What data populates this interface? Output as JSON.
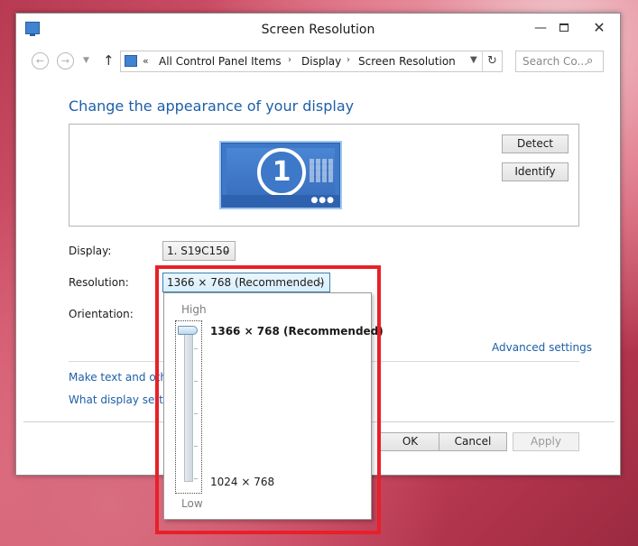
{
  "window": {
    "title": "Screen Resolution",
    "controls": {
      "minimize": "—",
      "maximize": "",
      "close": "✕"
    }
  },
  "address": {
    "chevrons": "«",
    "crumbs": [
      "All Control Panel Items",
      "Display",
      "Screen Resolution"
    ],
    "separator": "›",
    "search_placeholder": "Search Co..."
  },
  "main": {
    "heading": "Change the appearance of your display",
    "monitor_number": "1",
    "detect_label": "Detect",
    "identify_label": "Identify",
    "display_label": "Display:",
    "display_value": "1. S19C150",
    "resolution_label": "Resolution:",
    "resolution_value": "1366 × 768 (Recommended)",
    "orientation_label": "Orientation:",
    "advanced_link": "Advanced settings",
    "link_text_size": "Make text and other",
    "link_display_settings": "What display setting"
  },
  "footer": {
    "ok_label": "OK",
    "cancel_label": "Cancel",
    "apply_label": "Apply"
  },
  "resolution_popup": {
    "high_label": "High",
    "low_label": "Low",
    "top_option": "1366 × 768 (Recommended)",
    "bottom_option": "1024 × 768",
    "slider_position": 1.0
  },
  "colors": {
    "link": "#1e5fa8",
    "highlight": "#e8202a",
    "monitor": "#3d78c9"
  }
}
